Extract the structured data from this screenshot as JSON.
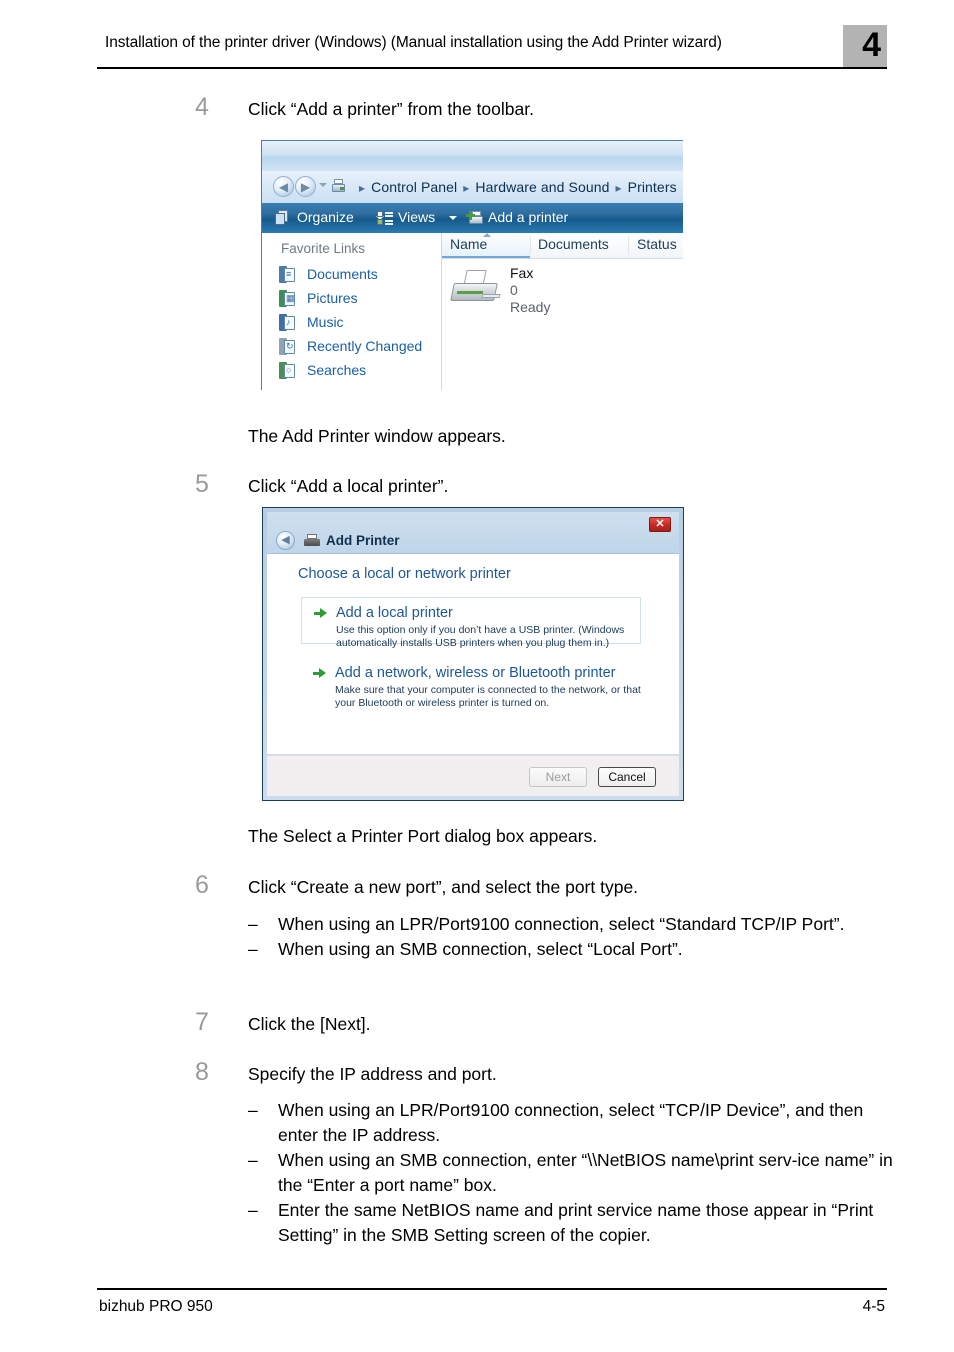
{
  "header": {
    "title": "Installation of the printer driver (Windows) (Manual installation using the Add Printer wizard)",
    "chapter": "4"
  },
  "footer": {
    "product": "bizhub PRO 950",
    "page": "4-5"
  },
  "steps": {
    "s4": {
      "num": "4",
      "text": "Click “Add a printer” from the toolbar."
    },
    "s4_result": "The Add Printer window appears.",
    "s5": {
      "num": "5",
      "text": "Click “Add a local printer”."
    },
    "s5_result": "The Select a Printer Port dialog box appears.",
    "s6": {
      "num": "6",
      "text": "Click “Create a new port”, and select the port type.",
      "dash": "–",
      "bullets": [
        "When using an LPR/Port9100 connection, select “Standard TCP/IP Port”.",
        "When using an SMB connection, select “Local Port”."
      ]
    },
    "s7": {
      "num": "7",
      "text": "Click the [Next]."
    },
    "s8": {
      "num": "8",
      "text": "Specify the IP address and port.",
      "dash": "–",
      "bullets": [
        "When using an LPR/Port9100 connection, select “TCP/IP Device”, and then enter the IP address.",
        "When using an SMB connection, enter “\\\\NetBIOS name\\print serv-ice name” in the “Enter a port name” box.",
        "Enter the same NetBIOS name and print service name those appear in “Print Setting” in the SMB Setting screen of the copier."
      ]
    }
  },
  "explorer": {
    "breadcrumbs": [
      "Control Panel",
      "Hardware and Sound",
      "Printers"
    ],
    "separator": "▸",
    "toolbar": {
      "organize": "Organize",
      "views": "Views",
      "add_printer": "Add a printer"
    },
    "sidebar": {
      "heading": "Favorite Links",
      "items": [
        {
          "label": "Documents",
          "glyph": "≣",
          "back": "#4a7ea8"
        },
        {
          "label": "Pictures",
          "glyph": "◧",
          "back": "#3f8f52"
        },
        {
          "label": "Music",
          "glyph": "♪",
          "back": "#3f6fa8"
        },
        {
          "label": "Recently Changed",
          "glyph": "↻",
          "back": "#8fa3b5"
        },
        {
          "label": "Searches",
          "glyph": "○",
          "back": "#4a8f56"
        }
      ]
    },
    "columns": [
      "Name",
      "Documents",
      "Status"
    ],
    "printer": {
      "name": "Fax",
      "documents": "0",
      "status": "Ready"
    }
  },
  "dialog": {
    "title": "Add Printer",
    "close_glyph": "✕",
    "heading": "Choose a local or network printer",
    "options": [
      {
        "title": "Add a local printer",
        "desc": "Use this option only if you don’t have a USB printer. (Windows automatically installs USB printers when you plug them in.)"
      },
      {
        "title": "Add a network, wireless or Bluetooth printer",
        "desc": "Make sure that your computer is connected to the network, or that your Bluetooth or wireless printer is turned on."
      }
    ],
    "buttons": {
      "next": "Next",
      "cancel": "Cancel"
    }
  },
  "colors": {
    "step_number": "#9a9a9a",
    "chapter_box": "#b3b3b3",
    "link_blue": "#1a5fa8",
    "heading_blue": "#1e5795",
    "toolbar_blue": "#2f6d9f",
    "arrow_green": "#2f9b34",
    "close_red": "#c92c25"
  }
}
